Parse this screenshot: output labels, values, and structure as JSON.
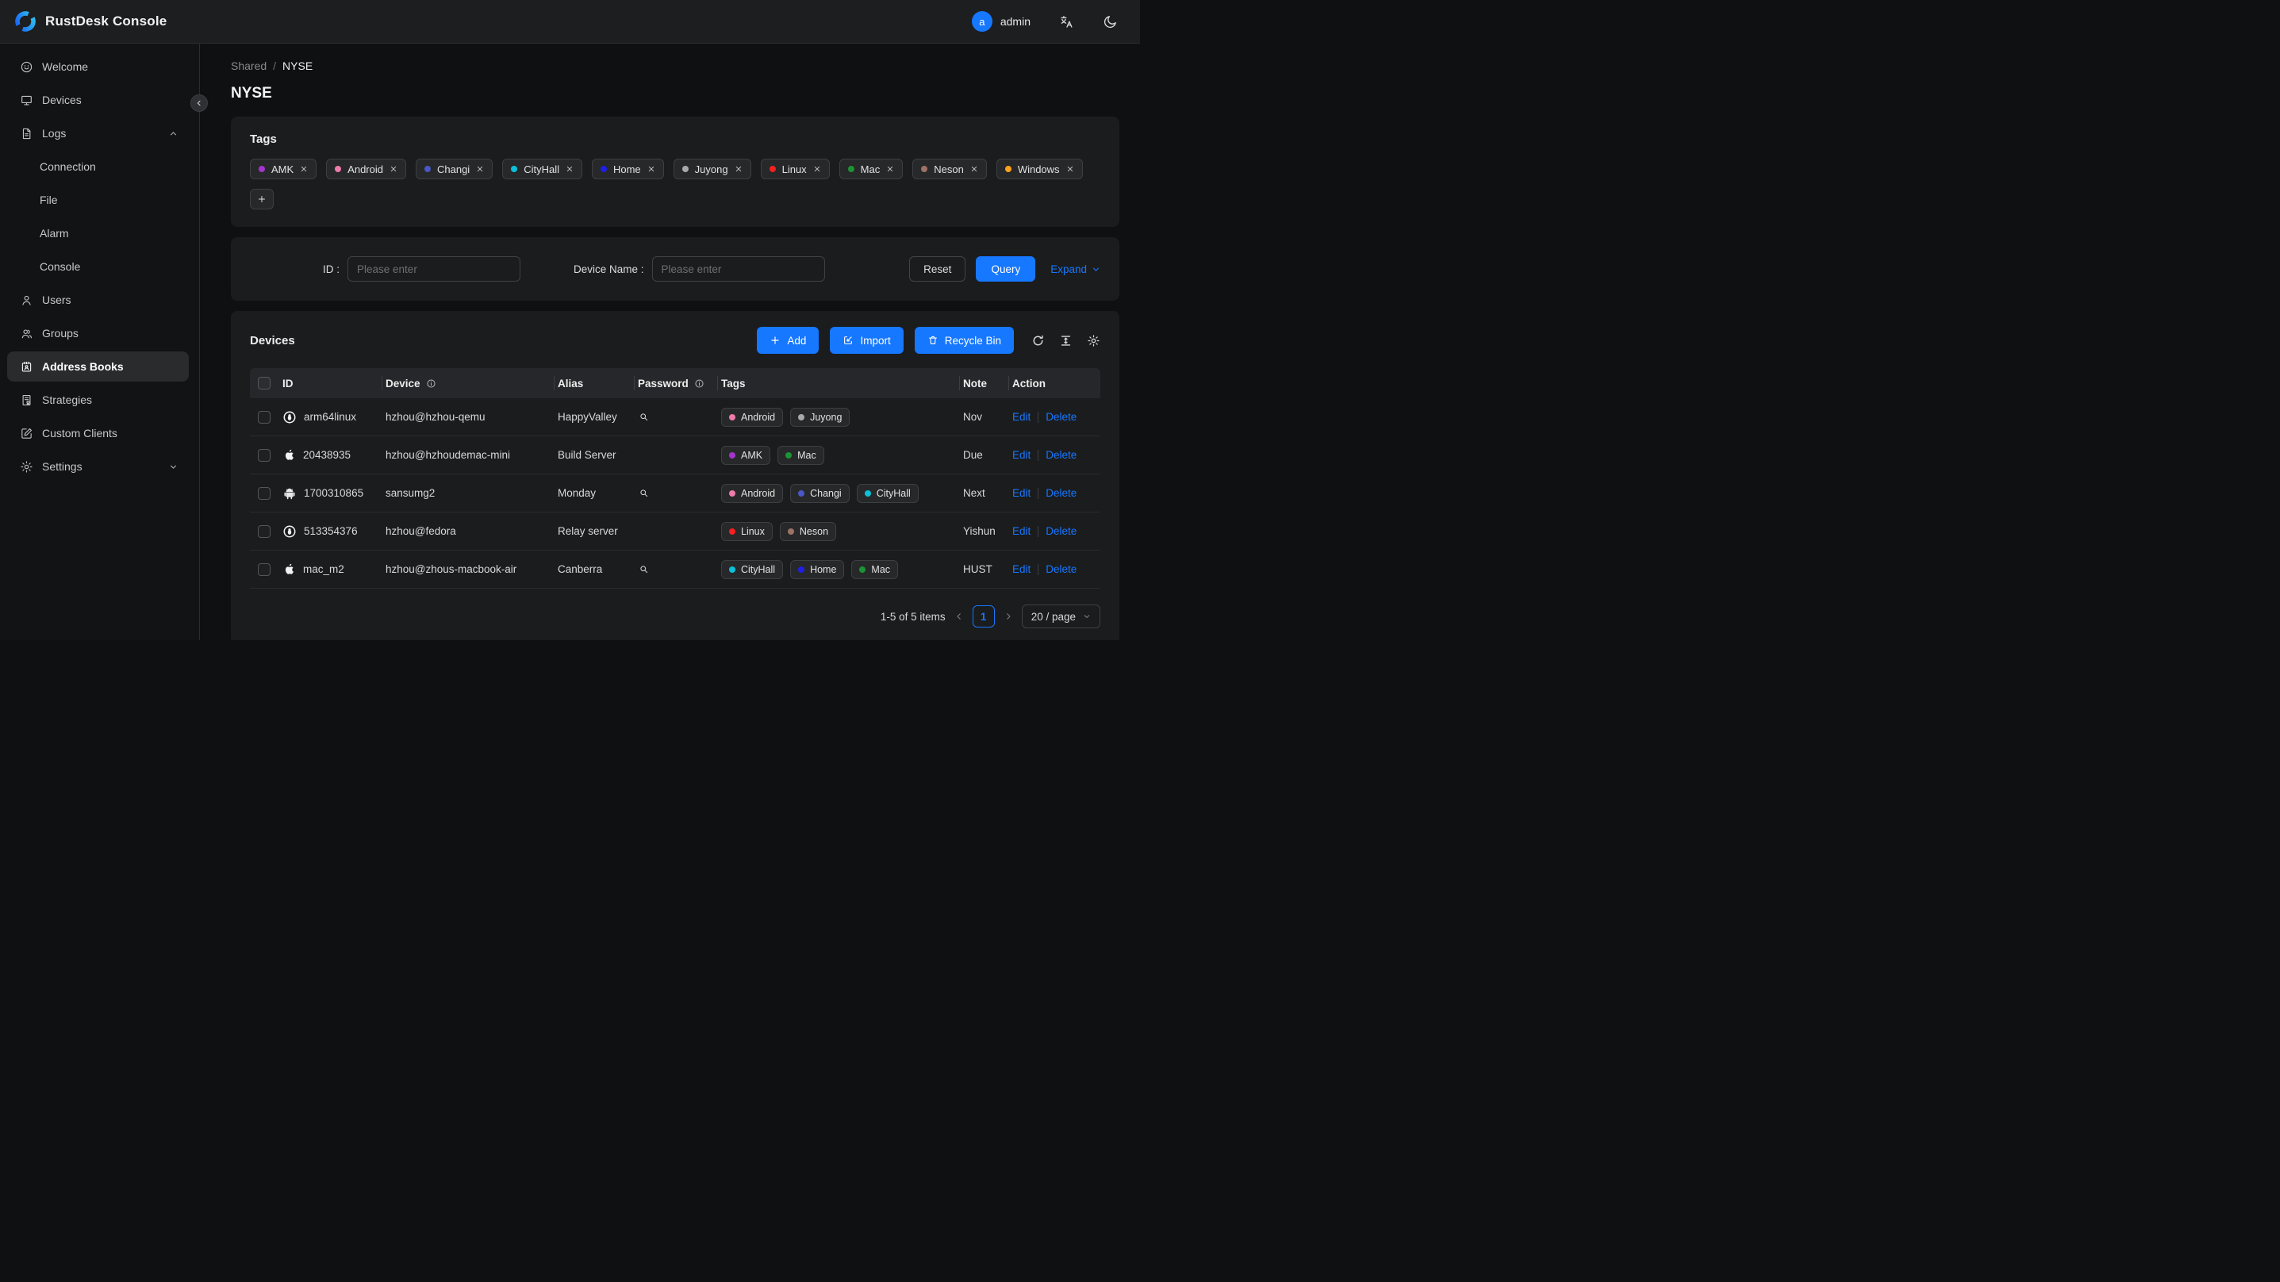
{
  "header": {
    "app_title": "RustDesk Console",
    "user": {
      "initial": "a",
      "name": "admin"
    }
  },
  "sidebar": {
    "items": [
      {
        "label": "Welcome",
        "icon": "smiley"
      },
      {
        "label": "Devices",
        "icon": "monitor"
      },
      {
        "label": "Logs",
        "icon": "document",
        "chevron": "up"
      },
      {
        "label": "Connection",
        "sub": true
      },
      {
        "label": "File",
        "sub": true
      },
      {
        "label": "Alarm",
        "sub": true
      },
      {
        "label": "Console",
        "sub": true
      },
      {
        "label": "Users",
        "icon": "user"
      },
      {
        "label": "Groups",
        "icon": "users"
      },
      {
        "label": "Address Books",
        "icon": "address-book",
        "selected": true
      },
      {
        "label": "Strategies",
        "icon": "strategy"
      },
      {
        "label": "Custom Clients",
        "icon": "edit-square"
      },
      {
        "label": "Settings",
        "icon": "gear",
        "chevron": "down"
      }
    ]
  },
  "breadcrumb": {
    "parent": "Shared",
    "separator": "/",
    "current": "NYSE"
  },
  "page": {
    "title": "NYSE"
  },
  "tag_colors": {
    "AMK": "#a335cc",
    "Android": "#ee7bab",
    "Changi": "#4a57c4",
    "CityHall": "#0cc0d8",
    "Home": "#1f1fe8",
    "Juyong": "#a9a9a9",
    "Linux": "#f32121",
    "Mac": "#1c9334",
    "Neson": "#9d7365",
    "Windows": "#ffa019"
  },
  "tags_card": {
    "title": "Tags",
    "tags": [
      "AMK",
      "Android",
      "Changi",
      "CityHall",
      "Home",
      "Juyong",
      "Linux",
      "Mac",
      "Neson",
      "Windows"
    ],
    "add_label": "+"
  },
  "filter": {
    "id_label": "ID :",
    "id_placeholder": "Please enter",
    "device_label": "Device Name :",
    "device_placeholder": "Please enter",
    "reset_label": "Reset",
    "query_label": "Query",
    "expand_label": "Expand"
  },
  "devices_card": {
    "title": "Devices",
    "add_label": "Add",
    "import_label": "Import",
    "recycle_label": "Recycle Bin"
  },
  "table": {
    "headers": [
      {
        "label": "ID",
        "info": false
      },
      {
        "label": "Device",
        "info": true
      },
      {
        "label": "Alias",
        "info": false
      },
      {
        "label": "Password",
        "info": true
      },
      {
        "label": "Tags",
        "info": false
      },
      {
        "label": "Note",
        "info": false
      },
      {
        "label": "Action",
        "info": false
      }
    ],
    "edit_label": "Edit",
    "delete_label": "Delete",
    "rows": [
      {
        "os": "linux",
        "id": "arm64linux",
        "device": "hzhou@hzhou-qemu",
        "alias": "HappyValley",
        "password_lookup": true,
        "tags": [
          "Android",
          "Juyong"
        ],
        "note": "Nov"
      },
      {
        "os": "apple",
        "id": "20438935",
        "device": "hzhou@hzhoudemac-mini",
        "alias": "Build Server",
        "password_lookup": false,
        "tags": [
          "AMK",
          "Mac"
        ],
        "note": "Due"
      },
      {
        "os": "android",
        "id": "1700310865",
        "device": "sansumg2",
        "alias": "Monday",
        "password_lookup": true,
        "tags": [
          "Android",
          "Changi",
          "CityHall"
        ],
        "note": "Next"
      },
      {
        "os": "linux",
        "id": "513354376",
        "device": "hzhou@fedora",
        "alias": "Relay server",
        "password_lookup": false,
        "tags": [
          "Linux",
          "Neson"
        ],
        "note": "Yishun"
      },
      {
        "os": "apple",
        "id": "mac_m2",
        "device": "hzhou@zhous-macbook-air",
        "alias": "Canberra",
        "password_lookup": true,
        "tags": [
          "CityHall",
          "Home",
          "Mac"
        ],
        "note": "HUST"
      }
    ]
  },
  "pagination": {
    "summary": "1-5 of 5 items",
    "page": "1",
    "size": "20 / page"
  }
}
